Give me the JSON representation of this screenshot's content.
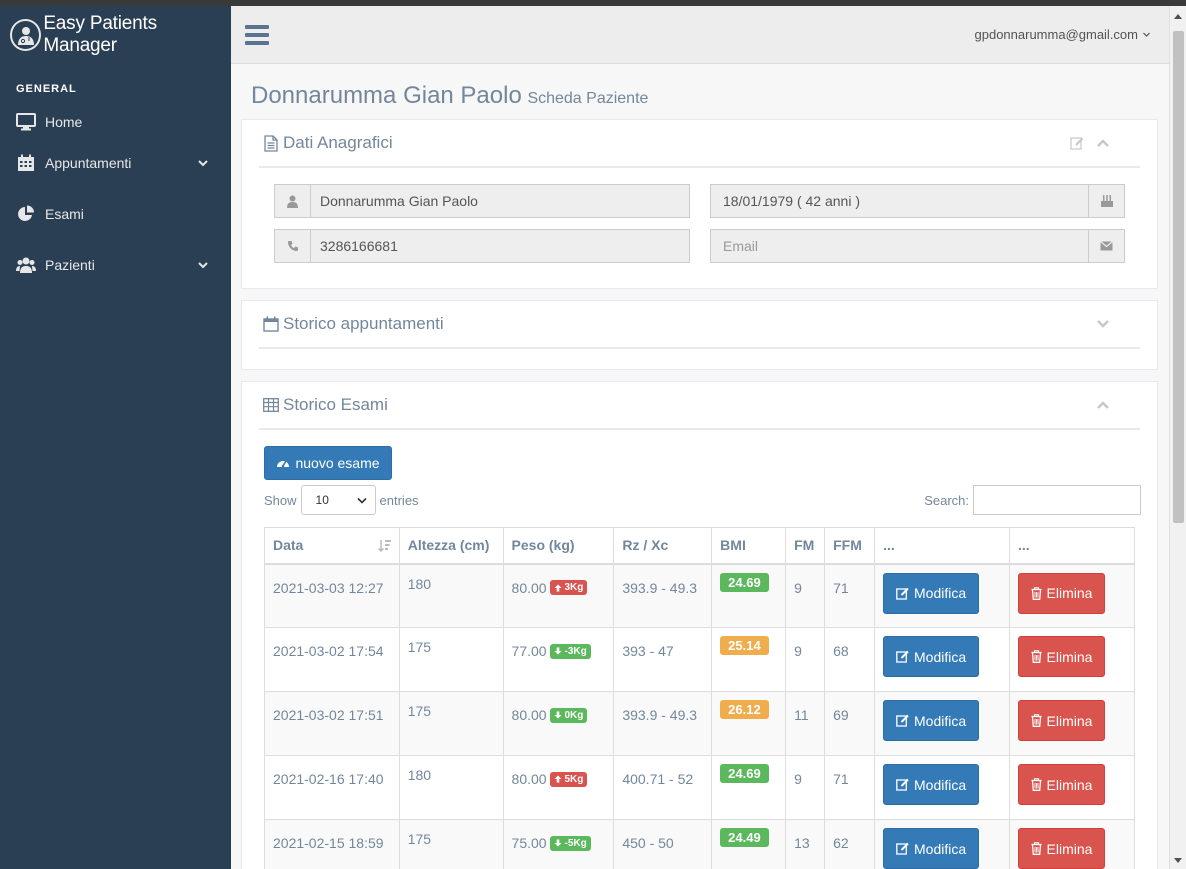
{
  "app": {
    "title": "Easy Patients Manager"
  },
  "sidebar": {
    "section_title": "GENERAL",
    "items": [
      {
        "label": "Home",
        "icon": "desktop-icon",
        "has_chevron": false
      },
      {
        "label": "Appuntamenti",
        "icon": "calendar-icon",
        "has_chevron": true
      },
      {
        "label": "Esami",
        "icon": "pie-chart-icon",
        "has_chevron": false
      },
      {
        "label": "Pazienti",
        "icon": "users-icon",
        "has_chevron": true
      }
    ]
  },
  "topnav": {
    "user_email": "gpdonnarumma@gmail.com"
  },
  "page": {
    "title": "Donnarumma Gian Paolo",
    "subtitle": "Scheda Paziente"
  },
  "anagrafica": {
    "title": "Dati Anagrafici",
    "name": "Donnarumma Gian Paolo",
    "birth": "18/01/1979 ( 42 anni )",
    "phone": "3286166681",
    "email_placeholder": "Email"
  },
  "storico_appuntamenti": {
    "title": "Storico appuntamenti"
  },
  "storico_esami": {
    "title": "Storico Esami",
    "new_button": "nuovo esame",
    "show_label": "Show",
    "entries_label": "entries",
    "page_length": "10",
    "search_label": "Search:",
    "columns": [
      "Data",
      "Altezza (cm)",
      "Peso (kg)",
      "Rz / Xc",
      "BMI",
      "FM",
      "FFM",
      "...",
      "..."
    ],
    "rows": [
      {
        "data": "2021-03-03 12:27",
        "altezza": "180",
        "peso": "80.00",
        "delta": "3Kg",
        "delta_dir": "up",
        "rzxc": "393.9 - 49.3",
        "bmi": "24.69",
        "bmi_color": "green",
        "fm": "9",
        "ffm": "71",
        "edit": "Modifica",
        "delete": "Elimina"
      },
      {
        "data": "2021-03-02 17:54",
        "altezza": "175",
        "peso": "77.00",
        "delta": "-3Kg",
        "delta_dir": "down",
        "rzxc": "393 - 47",
        "bmi": "25.14",
        "bmi_color": "orange",
        "fm": "9",
        "ffm": "68",
        "edit": "Modifica",
        "delete": "Elimina"
      },
      {
        "data": "2021-03-02 17:51",
        "altezza": "175",
        "peso": "80.00",
        "delta": "0Kg",
        "delta_dir": "down",
        "rzxc": "393.9 - 49.3",
        "bmi": "26.12",
        "bmi_color": "orange",
        "fm": "11",
        "ffm": "69",
        "edit": "Modifica",
        "delete": "Elimina"
      },
      {
        "data": "2021-02-16 17:40",
        "altezza": "180",
        "peso": "80.00",
        "delta": "5Kg",
        "delta_dir": "up",
        "rzxc": "400.71 - 52",
        "bmi": "24.69",
        "bmi_color": "green",
        "fm": "9",
        "ffm": "71",
        "edit": "Modifica",
        "delete": "Elimina"
      },
      {
        "data": "2021-02-15 18:59",
        "altezza": "175",
        "peso": "75.00",
        "delta": "-5Kg",
        "delta_dir": "down",
        "rzxc": "450 - 50",
        "bmi": "24.49",
        "bmi_color": "green",
        "fm": "13",
        "ffm": "62",
        "edit": "Modifica",
        "delete": "Elimina"
      }
    ]
  },
  "colors": {
    "sidebar_bg": "#2a3f54",
    "primary": "#337ab7",
    "danger": "#d9534f",
    "success": "#5cb85c",
    "warning": "#f0ad4e"
  }
}
